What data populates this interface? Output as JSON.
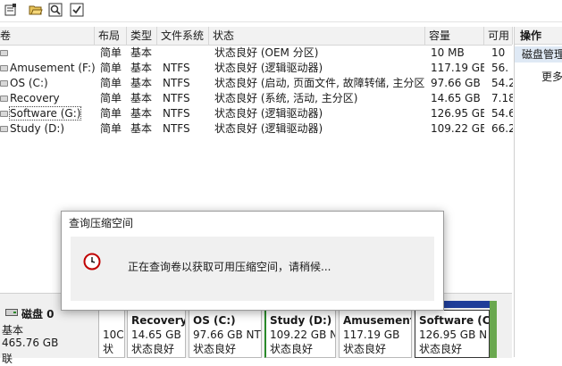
{
  "columns": [
    "卷",
    "布局",
    "类型",
    "文件系统",
    "状态",
    "容量",
    "可用"
  ],
  "rows": [
    {
      "name": "",
      "layout": "简单",
      "type": "基本",
      "fs": "",
      "status": "状态良好 (OEM 分区)",
      "capacity": "10 MB",
      "free": "10"
    },
    {
      "name": "Amusement  (F:)",
      "layout": "简单",
      "type": "基本",
      "fs": "NTFS",
      "status": "状态良好 (逻辑驱动器)",
      "capacity": "117.19 GB",
      "free": "56."
    },
    {
      "name": "OS (C:)",
      "layout": "简单",
      "type": "基本",
      "fs": "NTFS",
      "status": "状态良好 (启动, 页面文件, 故障转储, 主分区)",
      "capacity": "97.66 GB",
      "free": "54.2"
    },
    {
      "name": "Recovery",
      "layout": "简单",
      "type": "基本",
      "fs": "NTFS",
      "status": "状态良好 (系统, 活动, 主分区)",
      "capacity": "14.65 GB",
      "free": "7.18"
    },
    {
      "name": "Software (G:)",
      "layout": "简单",
      "type": "基本",
      "fs": "NTFS",
      "status": "状态良好 (逻辑驱动器)",
      "capacity": "126.95 GB",
      "free": "54.6"
    },
    {
      "name": "Study (D:)",
      "layout": "简单",
      "type": "基本",
      "fs": "NTFS",
      "status": "状态良好 (逻辑驱动器)",
      "capacity": "109.22 GB",
      "free": "66.2"
    }
  ],
  "actions": {
    "header": "操作",
    "section": "磁盘管理",
    "more": "更多"
  },
  "disk": {
    "name": "磁盘 0",
    "type": "基本",
    "size": "465.76 GB",
    "extra": "联"
  },
  "partitions": [
    {
      "name": "",
      "size": "10C",
      "status": "状"
    },
    {
      "name": "Recovery",
      "size": "14.65 GB",
      "status": "状态良好"
    },
    {
      "name": "OS  (C:)",
      "size": "97.66 GB NT",
      "status": "状态良好"
    },
    {
      "name": "Study  (D:)",
      "size": "109.22 GB N",
      "status": "状态良好"
    },
    {
      "name": "Amusement",
      "size": "117.19 GB",
      "status": "状态良好"
    },
    {
      "name": "Software  (C",
      "size": "126.95 GB N",
      "status": "状态良好"
    }
  ],
  "dialog": {
    "title": "查询压缩空间",
    "message": "正在查询卷以获取可用压缩空间，请稍候..."
  },
  "colors": {
    "partition_bar": "#1f3d99",
    "dialog_bg": "#f0f0f0",
    "actions_selected": "#dfe9f5"
  }
}
